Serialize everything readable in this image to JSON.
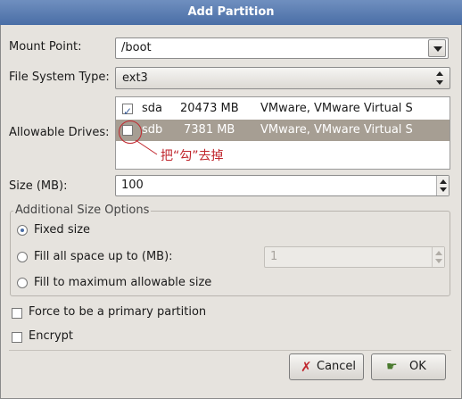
{
  "window": {
    "title": "Add Partition"
  },
  "mount_point": {
    "label": "Mount Point:",
    "value": "/boot"
  },
  "file_system_type": {
    "label": "File System Type:",
    "value": "ext3"
  },
  "allowable_drives": {
    "label": "Allowable Drives:",
    "rows": [
      {
        "checked": true,
        "name": "sda",
        "size": "20473 MB",
        "model": "VMware, VMware Virtual S"
      },
      {
        "checked": false,
        "name": "sdb",
        "size": "7381 MB",
        "model": "VMware, VMware Virtual S"
      }
    ]
  },
  "annotation": {
    "text": "把“勾”去掉",
    "color": "#c0262d"
  },
  "size": {
    "label": "Size (MB):",
    "value": "100"
  },
  "additional_size_options": {
    "legend": "Additional Size Options",
    "fixed_size": "Fixed size",
    "fill_up_to": "Fill all space up to (MB):",
    "fill_up_to_value": "1",
    "fill_max": "Fill to maximum allowable size",
    "selected": "fixed_size"
  },
  "force_primary": {
    "label": "Force to be a primary partition",
    "checked": false
  },
  "encrypt": {
    "label": "Encrypt",
    "checked": false
  },
  "buttons": {
    "cancel": "Cancel",
    "ok": "OK"
  },
  "colors": {
    "titlebar": "#4a6ea6",
    "selection": "#a69e93",
    "annotation": "#c0262d"
  }
}
